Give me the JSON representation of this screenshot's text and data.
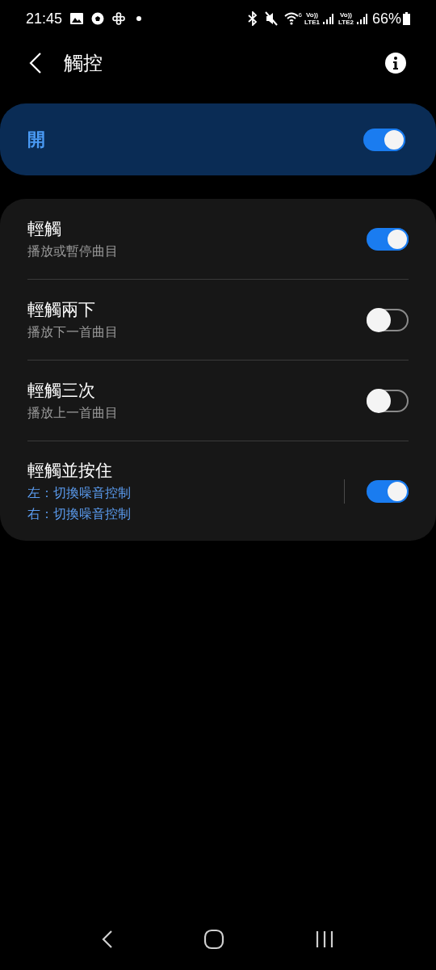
{
  "status_bar": {
    "time": "21:45",
    "wifi_badge": "6",
    "sim1": {
      "volte": "Vo))",
      "network": "LTE1"
    },
    "sim2": {
      "volte": "Vo))",
      "network": "LTE2"
    },
    "battery": "66%"
  },
  "header": {
    "title": "觸控"
  },
  "master": {
    "label": "開",
    "on": true
  },
  "items": [
    {
      "kind": "plain",
      "title": "輕觸",
      "subtitles": [
        "播放或暫停曲目"
      ],
      "on": true
    },
    {
      "kind": "plain",
      "title": "輕觸兩下",
      "subtitles": [
        "播放下一首曲目"
      ],
      "on": false
    },
    {
      "kind": "plain",
      "title": "輕觸三次",
      "subtitles": [
        "播放上一首曲目"
      ],
      "on": false
    },
    {
      "kind": "split",
      "title": "輕觸並按住",
      "subtitles": [
        "左：切換噪音控制",
        "右：切換噪音控制"
      ],
      "on": true
    }
  ]
}
